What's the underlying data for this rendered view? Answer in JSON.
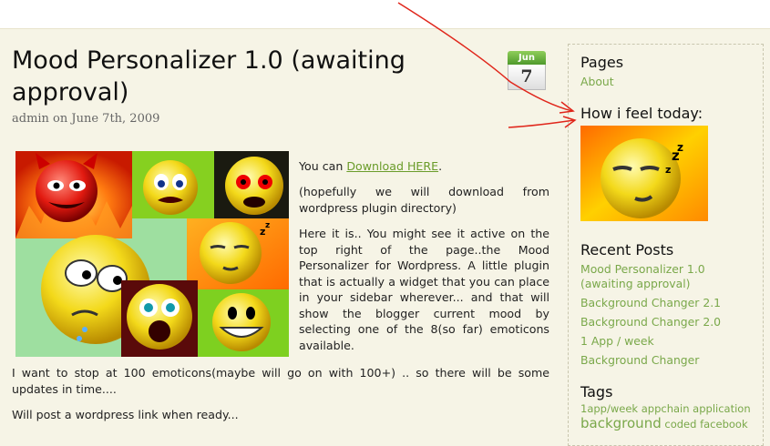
{
  "post": {
    "title": "Mood Personalizer 1.0 (awaiting approval)",
    "meta": "admin on June 7th, 2009",
    "date_month": "Jun",
    "date_day": "7",
    "p1_prefix": "You can ",
    "p1_link": "Download HERE",
    "p1_suffix": ".",
    "p2": "(hopefully we will download from wordpress plugin directory)",
    "p3": "Here it is.. You might see it active on the top right of the page..the Mood Personalizer for Wordpress. A little plugin that is actually a widget that you can place in your sidebar wherever... and that will show the blogger current mood by selecting one of the 8(so far) emoticons available.",
    "p4": "I want to stop at 100 emoticons(maybe will go on with 100+) .. so there will be some updates in time....",
    "p5": "Will post a wordpress link when ready..."
  },
  "sidebar": {
    "pages_heading": "Pages",
    "pages_items": [
      "About"
    ],
    "mood_heading": "How i feel today:",
    "recent_heading": "Recent Posts",
    "recent_items": [
      "Mood Personalizer 1.0 (awaiting approval)",
      "Background Changer 2.1",
      "Background Changer 2.0",
      "1 App / week",
      "Background Changer"
    ],
    "tags_heading": "Tags",
    "tags": [
      "1app/week",
      "appchain",
      "application",
      "background",
      "coded",
      "facebook"
    ]
  },
  "colors": {
    "link": "#7aa84a",
    "background": "#f6f4e6",
    "annotation": "#e0261b"
  }
}
